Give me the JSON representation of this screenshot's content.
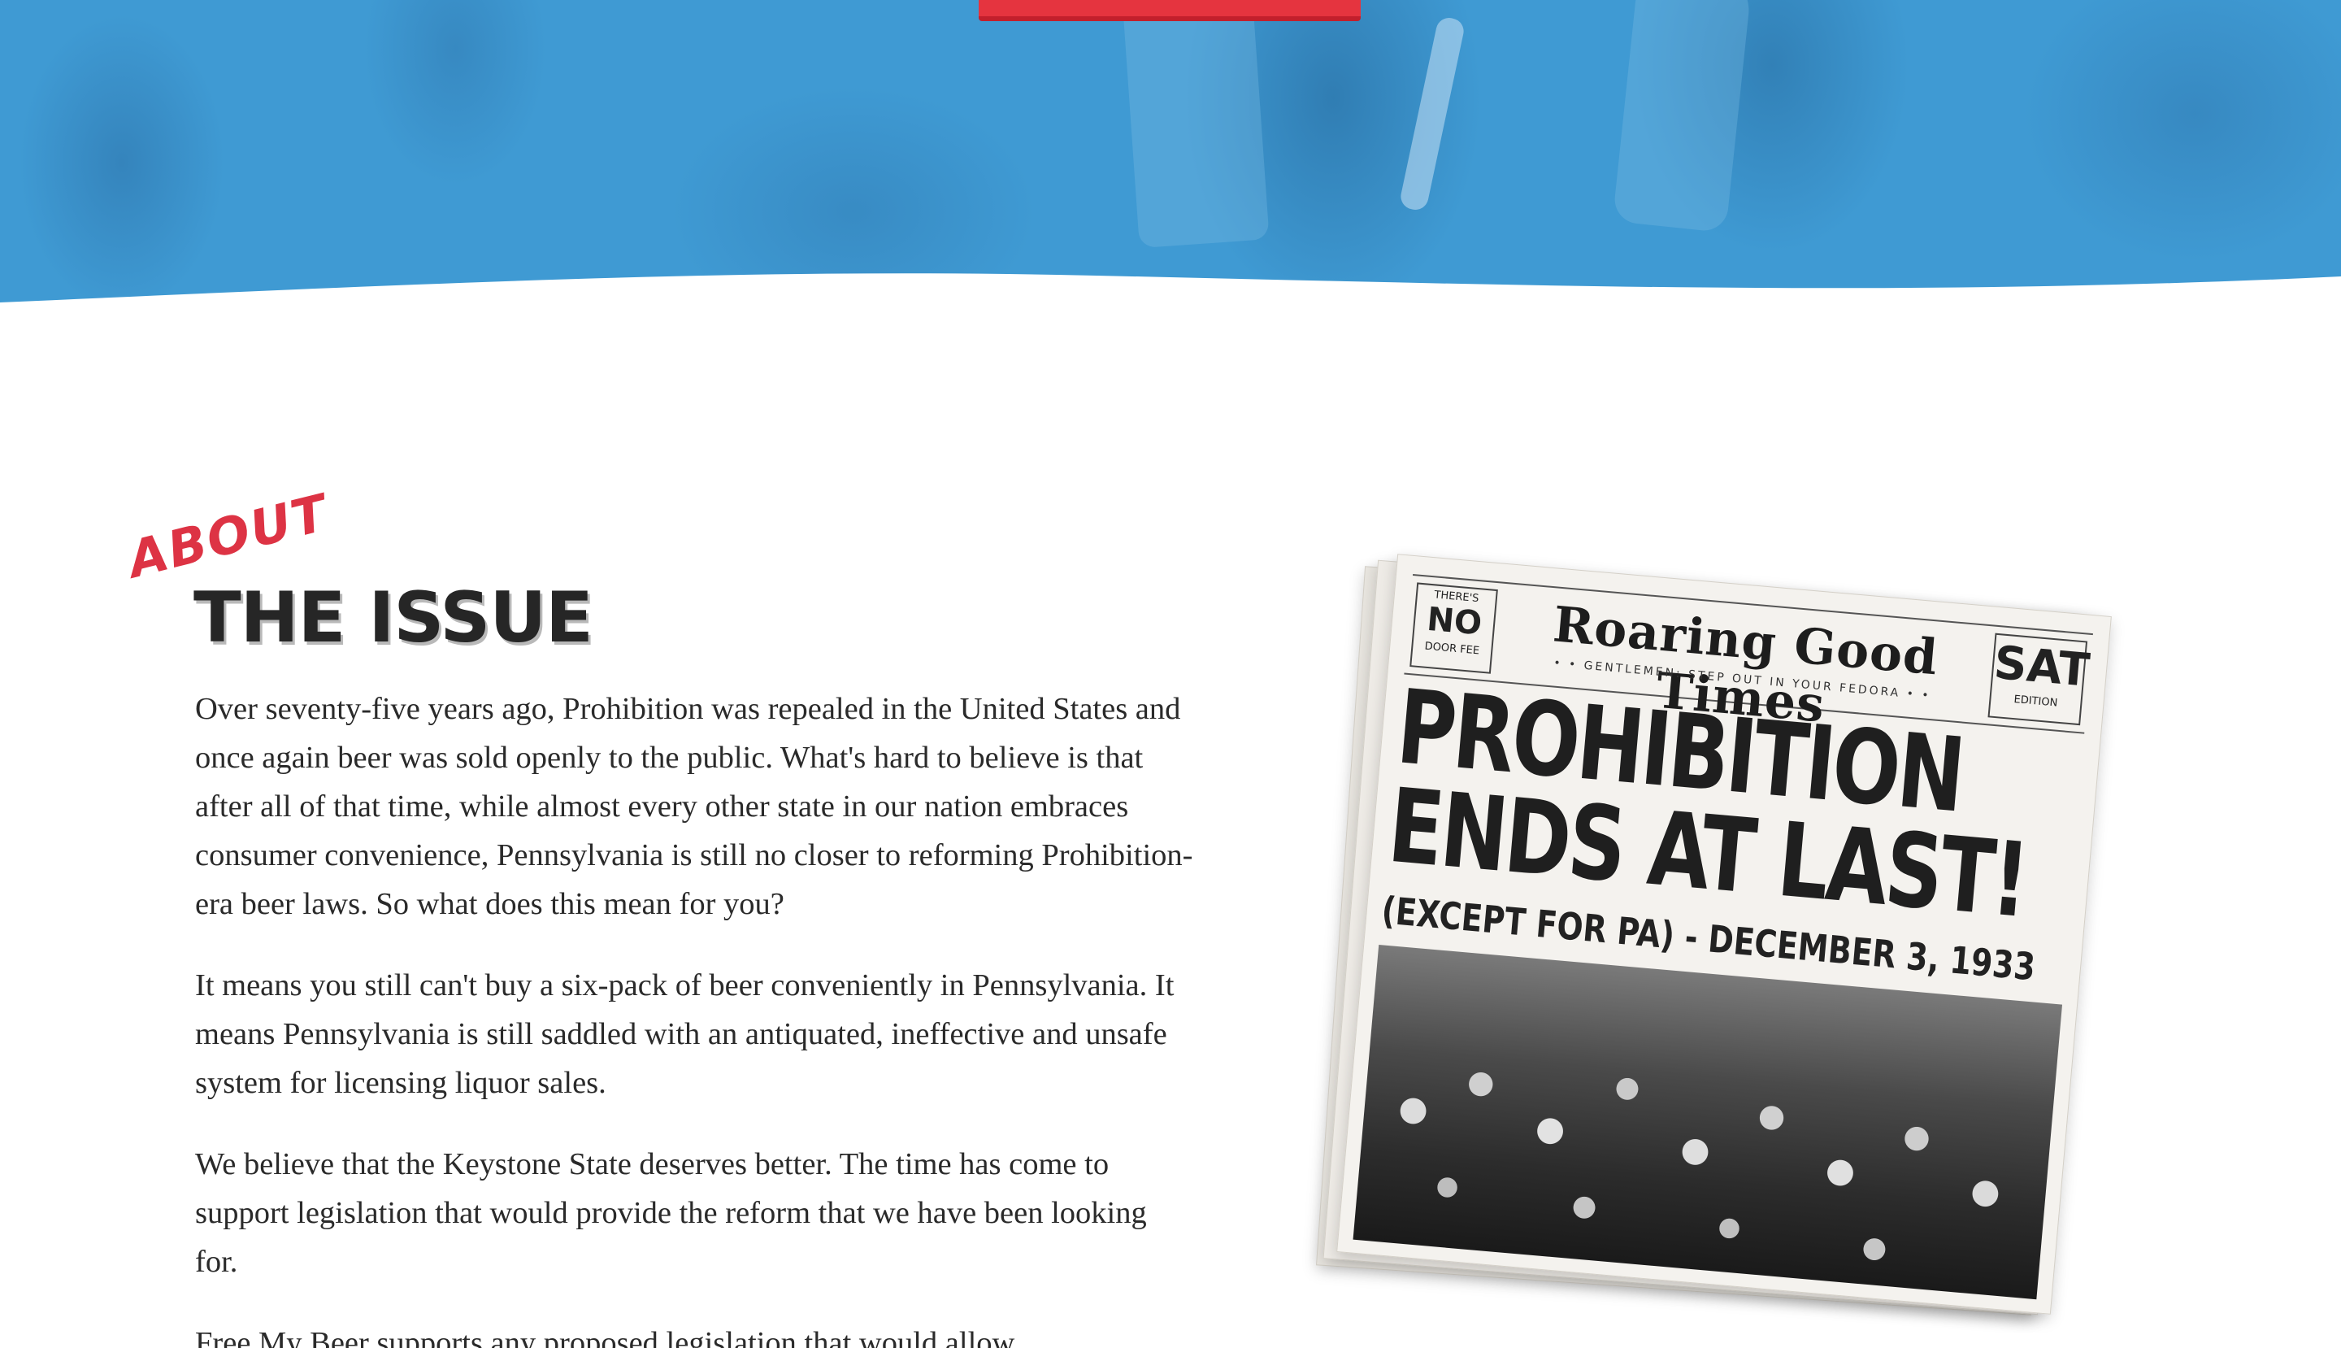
{
  "colors": {
    "hero_blue": "#3f9ad3",
    "accent_red": "#dd3344",
    "heading": "#262626",
    "body_text": "#2a2a2a"
  },
  "hero": {
    "cta_button_icon": "red-button-edge"
  },
  "about": {
    "eyebrow": "ABOUT",
    "title": "THE ISSUE",
    "paragraphs": [
      "Over seventy-five years ago, Prohibition was repealed in the United States and once again beer was sold openly to the public. What's hard to believe is that after all of that time, while almost every other state in our nation embraces consumer convenience, Pennsylvania is still no closer to reforming Prohibition-era beer laws. So what does this mean for you?",
      "It means you still can't buy a six-pack of beer conveniently in Pennsylvania. It means Pennsylvania is still saddled with an antiquated, ineffective and unsafe system for licensing liquor sales.",
      "We believe that the Keystone State deserves better. The time has come to support legislation that would provide the reform that we have been looking for.",
      "Free My Beer supports any proposed legislation that would allow"
    ]
  },
  "newspaper": {
    "box_left_top": "THERE'S",
    "box_left_big": "NO",
    "box_left_bottom": "DOOR FEE",
    "name": "Roaring Good Times",
    "tagline": "• • GENTLEMEN: STEP OUT IN YOUR FEDORA • •",
    "box_right_big": "SAT",
    "box_right_small": "EDITION",
    "headline_line1": "PROHIBITION",
    "headline_line2": "ENDS AT LAST!",
    "subline": "(EXCEPT FOR PA)   -   DECEMBER 3, 1933"
  }
}
